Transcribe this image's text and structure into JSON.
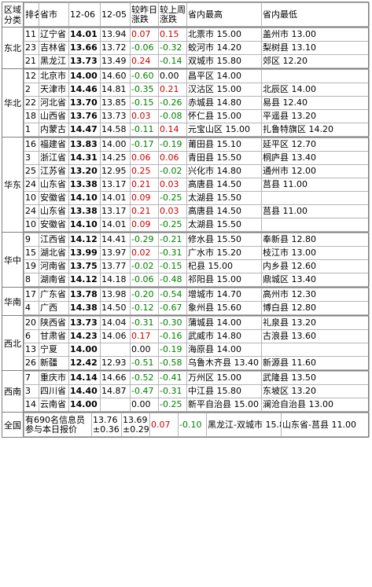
{
  "header": {
    "region": "区域分类",
    "rank": "排名",
    "province": "省市",
    "d1": "12-06",
    "d2": "12-05",
    "chg_day": "较昨日涨跌",
    "chg_week": "较上周涨跌",
    "max": "省内最高",
    "min": "省内最低"
  },
  "groups": [
    {
      "region": "东北",
      "rows": [
        {
          "rank": "11",
          "prov": "辽宁省",
          "p1": "14.01",
          "p2": "13.94",
          "cd": "0.07",
          "cw": "0.15",
          "hi": "北票市 15.00",
          "lo": "盖州市 13.00"
        },
        {
          "rank": "23",
          "prov": "吉林省",
          "p1": "13.66",
          "p2": "13.72",
          "cd": "-0.06",
          "cw": "-0.32",
          "hi": "蛟河市 14.20",
          "lo": "梨树县 13.10"
        },
        {
          "rank": "21",
          "prov": "黑龙江",
          "p1": "13.73",
          "p2": "13.49",
          "cd": "0.24",
          "cw": "-0.14",
          "hi": "双城市 15.80",
          "lo": "郊区 12.20"
        }
      ]
    },
    {
      "region": "华北",
      "rows": [
        {
          "rank": "12",
          "prov": "北京市",
          "p1": "14.00",
          "p2": "14.60",
          "cd": "-0.60",
          "cw": "0.00",
          "hi": "昌平区 14.00",
          "lo": ""
        },
        {
          "rank": "2",
          "prov": "天津市",
          "p1": "14.46",
          "p2": "14.81",
          "cd": "-0.35",
          "cw": "0.21",
          "hi": "汉沽区 15.00",
          "lo": "北辰区 14.00"
        },
        {
          "rank": "22",
          "prov": "河北省",
          "p1": "13.70",
          "p2": "13.85",
          "cd": "-0.15",
          "cw": "-0.26",
          "hi": "赤城县 14.80",
          "lo": "易县 12.40"
        },
        {
          "rank": "18",
          "prov": "山西省",
          "p1": "13.76",
          "p2": "13.73",
          "cd": "0.03",
          "cw": "-0.08",
          "hi": "怀仁县 15.00",
          "lo": "平遥县 13.20"
        },
        {
          "rank": "1",
          "prov": "内蒙古",
          "p1": "14.47",
          "p2": "14.58",
          "cd": "-0.11",
          "cw": "0.14",
          "hi": "元宝山区 15.00",
          "lo": "扎鲁特旗区 14.20"
        }
      ]
    },
    {
      "region": "华东",
      "rows": [
        {
          "rank": "16",
          "prov": "福建省",
          "p1": "13.83",
          "p2": "14.00",
          "cd": "-0.17",
          "cw": "-0.19",
          "hi": "莆田县 15.10",
          "lo": "延平区 12.70"
        },
        {
          "rank": "3",
          "prov": "浙江省",
          "p1": "14.31",
          "p2": "14.25",
          "cd": "0.06",
          "cw": "0.06",
          "hi": "青田县 15.50",
          "lo": "桐庐县 13.40"
        },
        {
          "rank": "25",
          "prov": "江苏省",
          "p1": "13.20",
          "p2": "12.95",
          "cd": "0.25",
          "cw": "-0.02",
          "hi": "兴化市 14.80",
          "lo": "通州市 12.00"
        },
        {
          "rank": "24",
          "prov": "山东省",
          "p1": "13.38",
          "p2": "13.17",
          "cd": "0.21",
          "cw": "0.03",
          "hi": "高唐县 14.50",
          "lo": "莒县 11.00"
        },
        {
          "rank": "10",
          "prov": "安徽省",
          "p1": "14.10",
          "p2": "14.01",
          "cd": "0.09",
          "cw": "-0.25",
          "hi": "太湖县 15.50",
          "lo": ""
        },
        {
          "rank": "24",
          "prov": "山东省",
          "p1": "13.38",
          "p2": "13.17",
          "cd": "0.21",
          "cw": "0.03",
          "hi": "高唐县 14.50",
          "lo": "莒县 11.00"
        },
        {
          "rank": "10",
          "prov": "安徽省",
          "p1": "14.10",
          "p2": "14.01",
          "cd": "0.09",
          "cw": "-0.25",
          "hi": "太湖县 15.50",
          "lo": ""
        }
      ]
    },
    {
      "region": "华中",
      "rows": [
        {
          "rank": "9",
          "prov": "江西省",
          "p1": "14.12",
          "p2": "14.41",
          "cd": "-0.29",
          "cw": "-0.21",
          "hi": "修水县 15.50",
          "lo": "奉新县 12.80"
        },
        {
          "rank": "15",
          "prov": "湖北省",
          "p1": "13.99",
          "p2": "13.97",
          "cd": "0.02",
          "cw": "-0.31",
          "hi": "广水市 15.20",
          "lo": "枝江市 13.00"
        },
        {
          "rank": "19",
          "prov": "河南省",
          "p1": "13.75",
          "p2": "13.77",
          "cd": "-0.02",
          "cw": "-0.15",
          "hi": "杞县 15.00",
          "lo": "内乡县 12.60"
        },
        {
          "rank": "8",
          "prov": "湖南省",
          "p1": "14.12",
          "p2": "14.18",
          "cd": "-0.06",
          "cw": "-0.48",
          "hi": "祁阳县 15.00",
          "lo": "鼎城区 13.40"
        }
      ]
    },
    {
      "region": "华南",
      "rows": [
        {
          "rank": "17",
          "prov": "广东省",
          "p1": "13.78",
          "p2": "13.98",
          "cd": "-0.20",
          "cw": "-0.54",
          "hi": "增城市 14.70",
          "lo": "高州市 12.30"
        },
        {
          "rank": "4",
          "prov": "广西",
          "p1": "14.38",
          "p2": "14.50",
          "cd": "-0.12",
          "cw": "-0.67",
          "hi": "象州县 15.60",
          "lo": "博白县 12.80"
        }
      ]
    },
    {
      "region": "西北",
      "rows": [
        {
          "rank": "20",
          "prov": "陕西省",
          "p1": "13.73",
          "p2": "14.04",
          "cd": "-0.31",
          "cw": "-0.30",
          "hi": "蒲城县 14.00",
          "lo": "礼泉县 13.20"
        },
        {
          "rank": "6",
          "prov": "甘肃省",
          "p1": "14.23",
          "p2": "14.06",
          "cd": "0.17",
          "cw": "-0.16",
          "hi": "武威市 14.80",
          "lo": "古浪县 13.60"
        },
        {
          "rank": "13",
          "prov": "宁夏",
          "p1": "14.00",
          "p2": "",
          "cd": "0.00",
          "cw": "-0.19",
          "hi": "海原县 14.00",
          "lo": ""
        },
        {
          "rank": "26",
          "prov": "新疆",
          "p1": "12.42",
          "p2": "12.93",
          "cd": "-0.51",
          "cw": "-0.58",
          "hi": "乌鲁木齐县 13.40",
          "lo": "新源县 11.60"
        }
      ]
    },
    {
      "region": "西南",
      "rows": [
        {
          "rank": "7",
          "prov": "重庆市",
          "p1": "14.14",
          "p2": "14.66",
          "cd": "-0.52",
          "cw": "-0.41",
          "hi": "万州区 15.00",
          "lo": "武隆县 13.50"
        },
        {
          "rank": "3",
          "prov": "四川省",
          "p1": "14.40",
          "p2": "14.87",
          "cd": "-0.47",
          "cw": "-0.31",
          "hi": "中江县 15.80",
          "lo": "东坡区 13.20"
        },
        {
          "rank": "14",
          "prov": "云南省",
          "p1": "14.00",
          "p2": "",
          "cd": "0.00",
          "cw": "-0.25",
          "hi": "新平自治县 15.00",
          "lo": "澜沧自治县 13.00"
        }
      ]
    }
  ],
  "national": {
    "region": "全国",
    "desc": "有690名信息员参与本日报价",
    "p1a": "13.76",
    "p1b": "±0.36",
    "p2a": "13.69",
    "p2b": "±0.29",
    "cd": "0.07",
    "cw": "-0.10",
    "hi": "黑龙江-双城市 15.80",
    "lo": "山东省-莒县 11.00"
  }
}
